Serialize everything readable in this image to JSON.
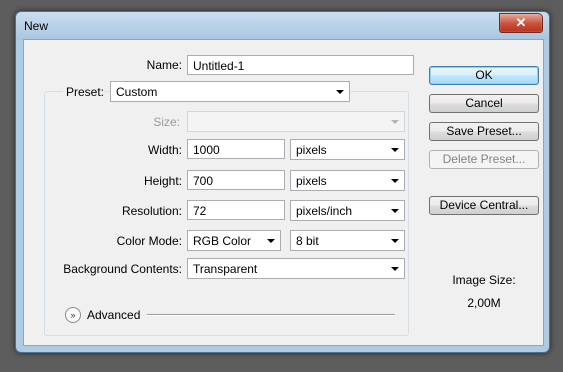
{
  "window": {
    "title": "New",
    "close_glyph": "✕"
  },
  "fields": {
    "name": {
      "label": "Name:",
      "value": "Untitled-1"
    },
    "preset": {
      "label": "Preset:",
      "value": "Custom"
    },
    "size": {
      "label": "Size:",
      "value": ""
    },
    "width": {
      "label": "Width:",
      "value": "1000",
      "unit": "pixels"
    },
    "height": {
      "label": "Height:",
      "value": "700",
      "unit": "pixels"
    },
    "resolution": {
      "label": "Resolution:",
      "value": "72",
      "unit": "pixels/inch"
    },
    "color_mode": {
      "label": "Color Mode:",
      "value": "RGB Color",
      "depth": "8 bit"
    },
    "background": {
      "label": "Background Contents:",
      "value": "Transparent"
    }
  },
  "advanced": {
    "label": "Advanced",
    "glyph": "»"
  },
  "buttons": {
    "ok": "OK",
    "cancel": "Cancel",
    "save_preset": "Save Preset...",
    "delete_preset": "Delete Preset...",
    "device_central": "Device Central..."
  },
  "image_size": {
    "label": "Image Size:",
    "value": "2,00M"
  }
}
